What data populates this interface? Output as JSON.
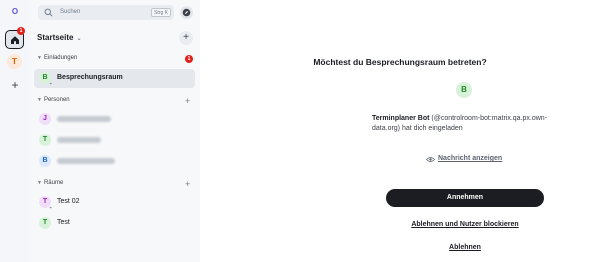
{
  "spacebar": {
    "account_initial": "O",
    "home_badge": "1",
    "space_initial": "T",
    "add_symbol": "+"
  },
  "roomlist": {
    "search_placeholder": "Suchen",
    "search_shortcut": "Strg K",
    "home_title": "Startseite",
    "home_chevron": "⌄",
    "add_symbol": "+",
    "sections": {
      "invites": {
        "label": "Einladungen",
        "badge": "1"
      },
      "people": {
        "label": "Personen"
      },
      "rooms": {
        "label": "Räume"
      }
    },
    "invites": [
      {
        "initial": "B",
        "name": "Besprechungsraum"
      }
    ],
    "people": [
      {
        "initial": "J"
      },
      {
        "initial": "T"
      },
      {
        "initial": "B"
      }
    ],
    "rooms": [
      {
        "initial": "T",
        "name": "Test 02"
      },
      {
        "initial": "T",
        "name": "Test"
      }
    ]
  },
  "invite": {
    "title": "Möchtest du Besprechungsraum betreten?",
    "avatar_initial": "B",
    "inviter_name": "Terminplaner Bot",
    "inviter_rest": " (@controlroom-bot:matrix.qa.px.own-data.org) hat dich eingeladen",
    "view_message": "Nachricht anzeigen",
    "accept": "Annehmen",
    "decline_block": "Ablehnen und Nutzer blockieren",
    "decline": "Ablehnen"
  },
  "colors": {
    "accent_dark": "#1b1d22",
    "badge_red": "#e0201a",
    "avatar_green": "#1f8a28",
    "avatar_purple": "#a21cc7",
    "avatar_blue": "#1868c9",
    "space_orange": "#e05d00"
  }
}
